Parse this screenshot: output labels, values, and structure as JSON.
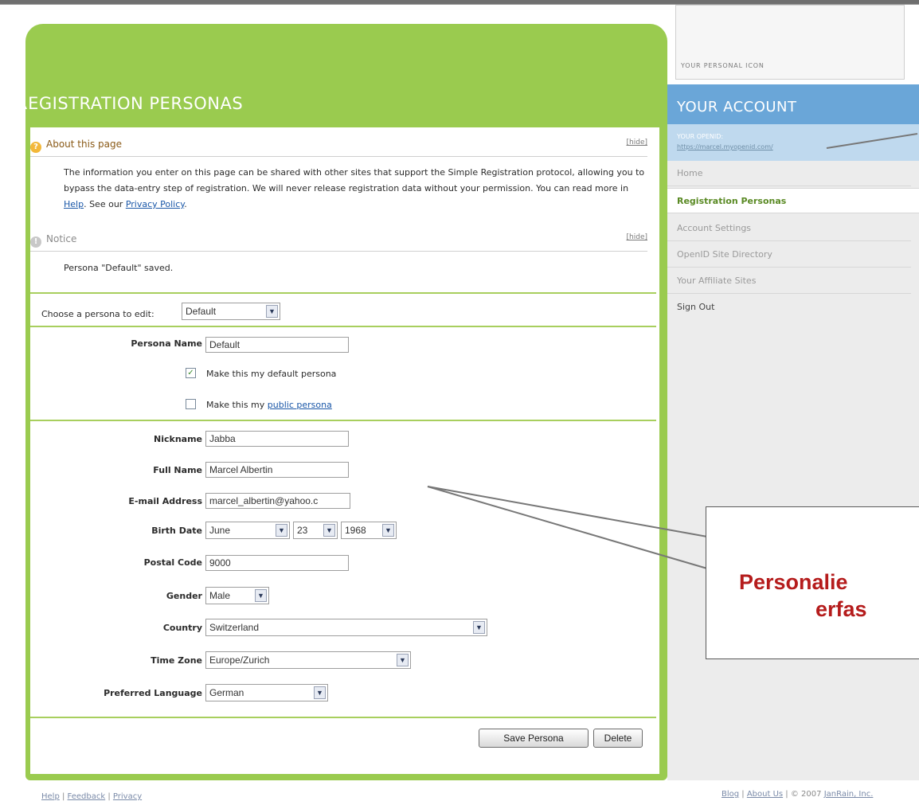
{
  "page": {
    "title": "REGISTRATION PERSONAS"
  },
  "about": {
    "heading": "About this page",
    "hide": "[hide]",
    "text_pre": "The information you enter on this page can be shared with other sites that support the Simple Registration protocol, allowing you to bypass the data-entry step of registration. We will never release registration data without your permission. You can read more in ",
    "help_link": "Help",
    "text_mid": ". See our ",
    "privacy_link": "Privacy Policy",
    "text_post": "."
  },
  "notice": {
    "heading": "Notice",
    "hide": "[hide]",
    "message": "Persona \"Default\" saved."
  },
  "persona_select": {
    "label": "Choose a persona to edit:",
    "value": "Default"
  },
  "persona": {
    "name_label": "Persona Name",
    "name_value": "Default",
    "default_label": "Make this my default persona",
    "default_checked": true,
    "public_label_pre": "Make this my ",
    "public_link": "public persona",
    "public_checked": false
  },
  "fields": {
    "nickname_label": "Nickname",
    "nickname_value": "Jabba",
    "fullname_label": "Full Name",
    "fullname_value": "Marcel Albertin",
    "email_label": "E-mail Address",
    "email_value": "marcel_albertin@yahoo.c",
    "birth_label": "Birth Date",
    "birth_month": "June",
    "birth_day": "23",
    "birth_year": "1968",
    "postal_label": "Postal Code",
    "postal_value": "9000",
    "gender_label": "Gender",
    "gender_value": "Male",
    "country_label": "Country",
    "country_value": "Switzerland",
    "timezone_label": "Time Zone",
    "timezone_value": "Europe/Zurich",
    "language_label": "Preferred Language",
    "language_value": "German"
  },
  "buttons": {
    "save": "Save Persona",
    "delete": "Delete"
  },
  "sidebar": {
    "icon_caption": "YOUR PERSONAL ICON",
    "account_title": "YOUR ACCOUNT",
    "openid_label": "YOUR OPENID:",
    "openid_url": "https://marcel.myopenid.com/",
    "items": [
      {
        "label": "Home"
      },
      {
        "label": "Registration Personas"
      },
      {
        "label": "Account Settings"
      },
      {
        "label": "OpenID Site Directory"
      },
      {
        "label": "Your Affiliate Sites"
      },
      {
        "label": "Sign Out"
      }
    ]
  },
  "annotation": {
    "line1": "Personalie",
    "line2": "erfas"
  },
  "footer": {
    "help": "Help",
    "feedback": "Feedback",
    "privacy": "Privacy",
    "blog": "Blog",
    "about": "About Us",
    "copyright": "© 2007",
    "company": "JanRain, Inc."
  },
  "colors": {
    "green_accent": "#9acb4f",
    "blue_accent": "#6aa6d8",
    "annotation_red": "#b51c1c"
  }
}
